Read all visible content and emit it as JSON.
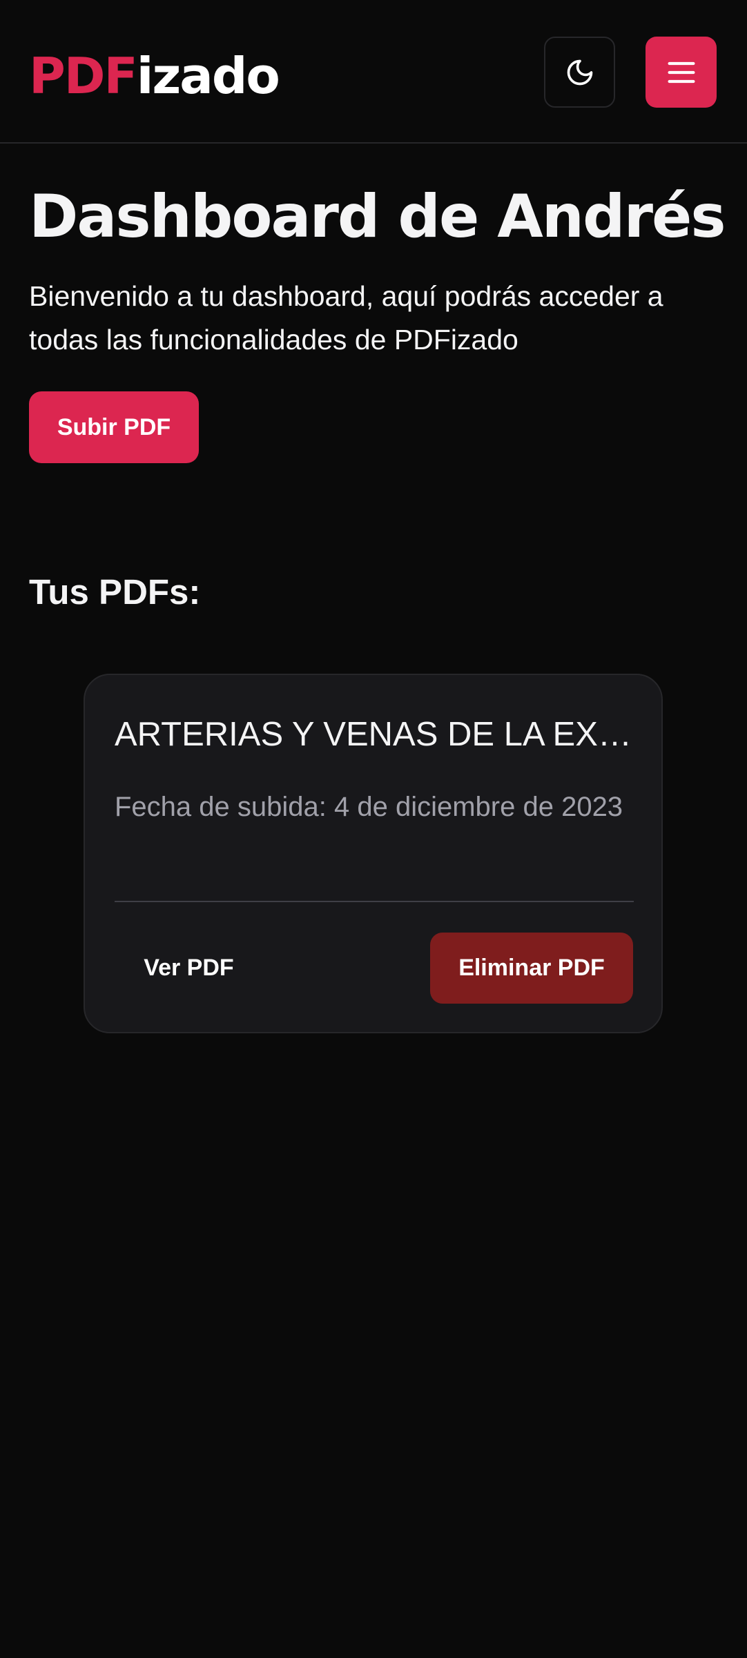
{
  "header": {
    "logo_accent": "PDF",
    "logo_rest": "izado",
    "theme_toggle_icon": "moon-icon",
    "menu_icon": "hamburger-menu-icon"
  },
  "main": {
    "title": "Dashboard de Andrés",
    "intro": "Bienvenido a tu dashboard, aquí podrás acceder a todas las funcionalidades de PDFizado",
    "upload_label": "Subir PDF",
    "section_title": "Tus PDFs:"
  },
  "pdfs": [
    {
      "title": "ARTERIAS Y VENAS DE LA EXTREMIDAD",
      "date": "Fecha de subida: 4 de diciembre de 2023",
      "view_label": "Ver PDF",
      "delete_label": "Eliminar PDF"
    }
  ],
  "colors": {
    "background": "#0a0a0a",
    "accent": "#dc2650",
    "card": "#18181b",
    "danger": "#7f1d1d",
    "muted_text": "#a1a1aa"
  }
}
